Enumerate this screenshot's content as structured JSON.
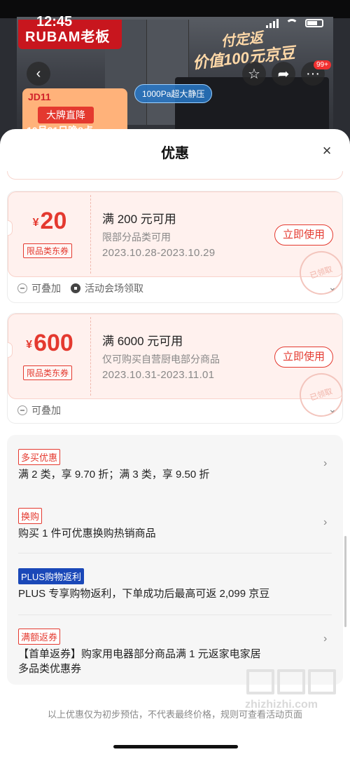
{
  "status_bar": {
    "time": "12:45"
  },
  "product_bg": {
    "brand": "RUBAM老板",
    "promo_line1": "付定返",
    "promo_line2": "价值100元京豆",
    "feature_pill": "1000Pa超大静压",
    "cart_badge": "99+",
    "event_logo": "JD11",
    "event_label": "大牌直降",
    "event_date": "10月31日晚8点"
  },
  "sheet": {
    "title": "优惠",
    "close_label": "×"
  },
  "coupons": [
    {
      "currency": "¥",
      "amount": "20",
      "category_tag": "限品类东券",
      "condition": "满 200 元可用",
      "scope": "限部分品类可用",
      "dates": "2023.10.28-2023.10.29",
      "button": "立即使用",
      "stamp": "已领取",
      "footer": [
        "可叠加",
        "活动会场领取"
      ]
    },
    {
      "currency": "¥",
      "amount": "600",
      "category_tag": "限品类东券",
      "condition": "满 6000 元可用",
      "scope": "仅可购买自营厨电部分商品",
      "dates": "2023.10.31-2023.11.01",
      "button": "立即使用",
      "stamp": "已领取",
      "footer": [
        "可叠加"
      ]
    }
  ],
  "promotions": [
    {
      "tag": "多买优惠",
      "tag_style": "red",
      "desc": "满 2 类，享 9.70 折；满 3 类，享 9.50 折",
      "has_arrow": true
    },
    {
      "tag": "换购",
      "tag_style": "red",
      "desc": "购买 1 件可优惠换购热销商品",
      "has_arrow": true
    },
    {
      "tag": "PLUS购物返利",
      "tag_style": "blue",
      "desc": "PLUS 专享购物返利，下单成功后最高可返 2,099 京豆",
      "has_arrow": false
    },
    {
      "tag": "满额返券",
      "tag_style": "red",
      "desc_line1": "【首单返券】购家用电器部分商品满 1 元返家电家居",
      "desc_line2": "多品类优惠券",
      "has_arrow": true
    }
  ],
  "footnote": "以上优惠仅为初步预估，不代表最终价格，规则可查看活动页面",
  "watermark": "zhizhizhi.com",
  "colors": {
    "accent_red": "#e4392f",
    "plus_blue": "#1a48b8",
    "coupon_bg": "#fff1ee"
  }
}
